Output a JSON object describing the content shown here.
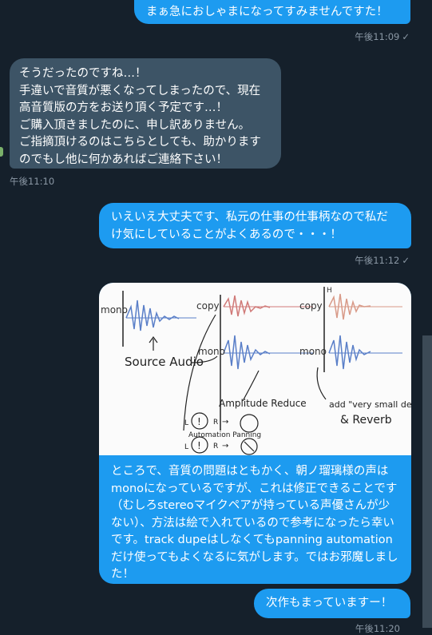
{
  "messages": {
    "m1": {
      "text": "まぁ急におしゃまになってすみませんですた！",
      "time": "午後11:09",
      "status": "✓"
    },
    "m2": {
      "text": "そうだったのですね…！\n手違いで音質が悪くなってしまったので、現在高音質版の方をお送り頂く予定です…！\nご購入頂きましたのに、申し訳ありません。\nご指摘頂けるのはこちらとしても、助かりますのでもし他に何かあればご連絡下さい！",
      "time": "午後11:10"
    },
    "m3": {
      "text": "いえいえ大丈夫です、私元の仕事の仕事柄なので私だけ気にしていることがよくあるので・・・！",
      "time": "午後11:12",
      "status": "✓"
    },
    "m4": {
      "caption": "ところで、音質の問題はともかく、朝ノ瑠璃様の声はmonoになっているですが、これは修正できることです（むしろstereoマイクペアが持っている声優さんが少ない）、方法は絵で入れているので参考になったら幸いです。track dupeはしなくてもpanning automationだけ使ってもよくなるに気がします。ではお邪魔しました！",
      "image_labels": {
        "mono": "mono",
        "copy1": "copy",
        "copy2": "copy",
        "mono2": "mono",
        "source": "Source Audio",
        "amp": "Amplitude Reduce",
        "delay": "add \"very small delay\"",
        "reverb": "& Reverb",
        "automation": "Automation Panning",
        "L1": "L",
        "R1": "R",
        "L2": "L",
        "R2": "R",
        "H": "H"
      }
    },
    "m5": {
      "text": "次作もまっていますー！",
      "time": "午後11:20"
    }
  }
}
